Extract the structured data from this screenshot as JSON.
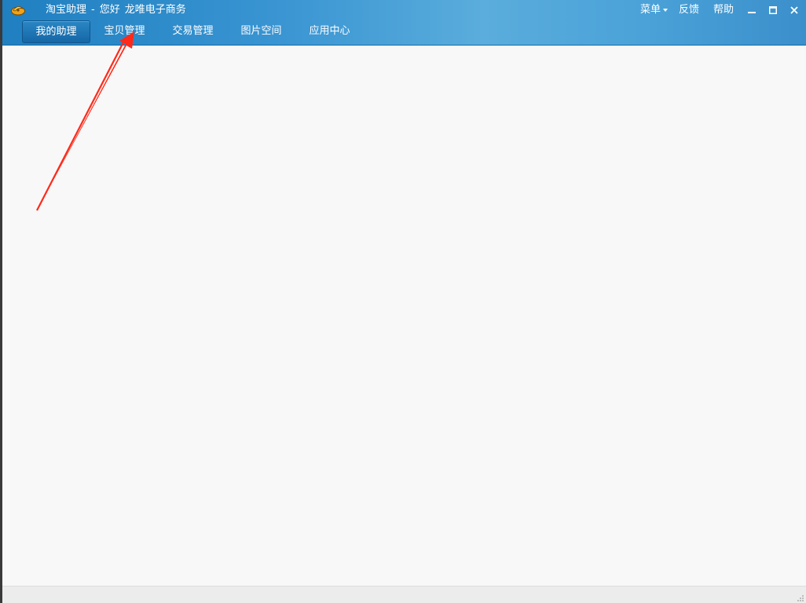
{
  "window": {
    "title": "淘宝助理",
    "separator": "-",
    "greeting": "您好",
    "account": "龙唯电子商务"
  },
  "top_links": {
    "menu": "菜单",
    "feedback": "反馈",
    "help": "帮助"
  },
  "tabs": [
    {
      "label": "我的助理",
      "active": true
    },
    {
      "label": "宝贝管理",
      "active": false
    },
    {
      "label": "交易管理",
      "active": false
    },
    {
      "label": "图片空间",
      "active": false
    },
    {
      "label": "应用中心",
      "active": false
    }
  ],
  "icons": {
    "logo": "taobao-logo-icon",
    "minimize": "minimize-icon",
    "maximize": "maximize-icon",
    "close": "close-icon",
    "annotation": "red-arrow-icon"
  },
  "colors": {
    "titlebar": "#3a95d2",
    "active_tab": "#1667a6",
    "annotation": "#ff2a1a"
  }
}
